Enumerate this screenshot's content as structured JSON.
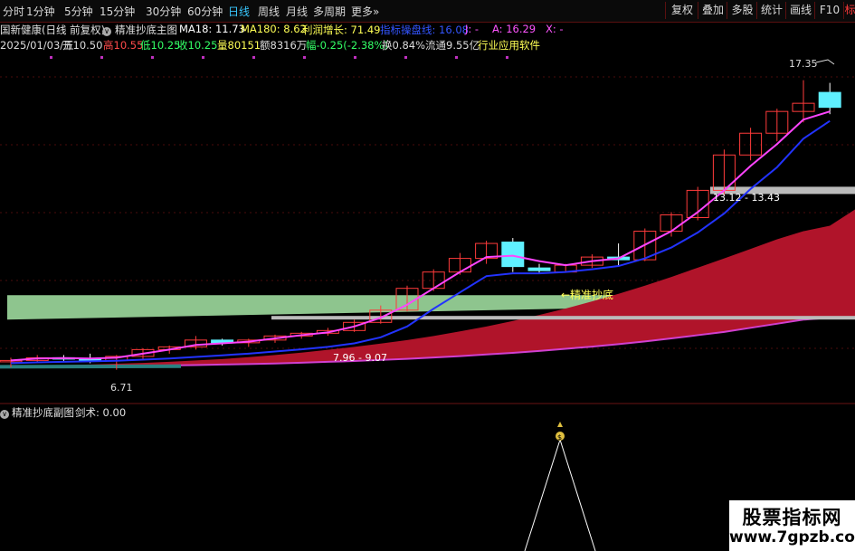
{
  "toolbar": {
    "timeframes": [
      "分时",
      "1分钟",
      "5分钟",
      "15分钟",
      "30分钟",
      "60分钟",
      "日线",
      "周线",
      "月线",
      "多周期",
      "更多"
    ],
    "active_timeframe": "日线",
    "right_buttons": [
      "复权",
      "叠加",
      "多股",
      "统计",
      "画线",
      "F10",
      "标"
    ],
    "active_right": "标"
  },
  "header": {
    "stock_name": "国新健康(日线 前复权)",
    "indicator_name": "精准抄底主图",
    "ma18_label": "MA18: 11.73",
    "ma180_label": "MA180: 8.62",
    "profit_label": "利润增长: 71.49",
    "extra_label": "指标操盘线: 16.08",
    "j_label": "J: -",
    "a_label": "A: 16.29",
    "x_label": "X: -",
    "date": "2025/01/03/五",
    "open_label": "开10.50",
    "high_label": "高10.55",
    "low_label": "低10.25",
    "close_label": "收10.25",
    "volume_label": "量80151",
    "amount_label": "额8316万",
    "change_label": "幅-0.25(-2.38%)",
    "turnover_label": "换0.84%",
    "float_label": "流通9.55亿",
    "industry_label": "行业应用软件"
  },
  "annotations": {
    "high_price": "17.35",
    "low_price": "6.71",
    "range_low": "7.96 - 9.07",
    "range_high": "13.12 - 13.43",
    "signal_text": "←精准抄底"
  },
  "sub_panel": {
    "title": "精准抄底副图",
    "value_label": "剑术: 0.00",
    "signal_marker": "$"
  },
  "watermark": {
    "line1": "股票指标网",
    "line2": "www.7gpzb.com"
  },
  "colors": {
    "up_candle": "#ff3b3b",
    "down_candle": "#5ff0ff",
    "ma_fast": "#ff44ff",
    "ma_slow": "#2233ff",
    "cloud_red": "#b0142a",
    "band_green": "#8ec58e",
    "active_tab": "#39c8ff"
  },
  "chart_data": {
    "type": "candlestick",
    "price_range": [
      6.0,
      18.3
    ],
    "candles": [
      {
        "o": 7.0,
        "h": 7.15,
        "l": 6.8,
        "c": 7.05
      },
      {
        "o": 7.05,
        "h": 7.25,
        "l": 6.95,
        "c": 7.15
      },
      {
        "o": 7.15,
        "h": 7.25,
        "l": 7.0,
        "c": 7.1
      },
      {
        "o": 7.1,
        "h": 7.3,
        "l": 6.95,
        "c": 7.05
      },
      {
        "o": 7.05,
        "h": 7.25,
        "l": 6.71,
        "c": 7.2
      },
      {
        "o": 7.2,
        "h": 7.5,
        "l": 7.1,
        "c": 7.45
      },
      {
        "o": 7.45,
        "h": 7.6,
        "l": 7.3,
        "c": 7.55
      },
      {
        "o": 7.55,
        "h": 7.95,
        "l": 7.45,
        "c": 7.8
      },
      {
        "o": 7.8,
        "h": 7.85,
        "l": 7.6,
        "c": 7.7
      },
      {
        "o": 7.7,
        "h": 7.85,
        "l": 7.55,
        "c": 7.8
      },
      {
        "o": 7.8,
        "h": 8.0,
        "l": 7.7,
        "c": 7.95
      },
      {
        "o": 7.95,
        "h": 8.1,
        "l": 7.85,
        "c": 8.05
      },
      {
        "o": 8.05,
        "h": 8.25,
        "l": 7.96,
        "c": 8.15
      },
      {
        "o": 8.15,
        "h": 8.55,
        "l": 8.1,
        "c": 8.45
      },
      {
        "o": 8.45,
        "h": 9.07,
        "l": 8.4,
        "c": 8.9
      },
      {
        "o": 8.9,
        "h": 9.8,
        "l": 8.85,
        "c": 9.7
      },
      {
        "o": 9.7,
        "h": 10.4,
        "l": 9.6,
        "c": 10.3
      },
      {
        "o": 10.3,
        "h": 11.0,
        "l": 10.2,
        "c": 10.8
      },
      {
        "o": 10.8,
        "h": 11.45,
        "l": 10.6,
        "c": 11.35
      },
      {
        "o": 11.4,
        "h": 11.55,
        "l": 10.3,
        "c": 10.5
      },
      {
        "o": 10.45,
        "h": 10.6,
        "l": 10.25,
        "c": 10.35
      },
      {
        "o": 10.3,
        "h": 10.6,
        "l": 10.3,
        "c": 10.55
      },
      {
        "o": 10.55,
        "h": 10.95,
        "l": 10.45,
        "c": 10.85
      },
      {
        "o": 10.85,
        "h": 11.35,
        "l": 10.55,
        "c": 10.75
      },
      {
        "o": 10.75,
        "h": 11.9,
        "l": 10.7,
        "c": 11.8
      },
      {
        "o": 11.8,
        "h": 12.5,
        "l": 11.6,
        "c": 12.4
      },
      {
        "o": 12.3,
        "h": 13.43,
        "l": 12.2,
        "c": 13.3
      },
      {
        "o": 13.3,
        "h": 14.8,
        "l": 13.12,
        "c": 14.6
      },
      {
        "o": 14.6,
        "h": 15.6,
        "l": 14.4,
        "c": 15.4
      },
      {
        "o": 15.4,
        "h": 16.3,
        "l": 15.1,
        "c": 16.2
      },
      {
        "o": 16.2,
        "h": 17.35,
        "l": 15.8,
        "c": 16.5
      },
      {
        "o": 16.9,
        "h": 17.25,
        "l": 16.1,
        "c": 16.35
      }
    ],
    "ma_fast": [
      7.05,
      7.12,
      7.14,
      7.12,
      7.15,
      7.3,
      7.45,
      7.62,
      7.68,
      7.74,
      7.86,
      7.98,
      8.08,
      8.3,
      8.62,
      9.1,
      9.7,
      10.3,
      10.85,
      10.9,
      10.7,
      10.55,
      10.7,
      10.8,
      11.3,
      11.8,
      12.5,
      13.3,
      14.2,
      15.0,
      15.9,
      16.2
    ],
    "ma_slow": [
      6.95,
      6.98,
      7.0,
      7.02,
      7.04,
      7.08,
      7.12,
      7.18,
      7.24,
      7.3,
      7.38,
      7.46,
      7.55,
      7.68,
      7.9,
      8.3,
      8.95,
      9.55,
      10.15,
      10.25,
      10.25,
      10.3,
      10.4,
      10.52,
      10.8,
      11.2,
      11.75,
      12.45,
      13.35,
      14.15,
      15.2,
      15.85
    ],
    "cloud_upper": [
      6.85,
      6.86,
      6.88,
      6.9,
      6.93,
      6.96,
      7.0,
      7.05,
      7.1,
      7.17,
      7.25,
      7.34,
      7.44,
      7.55,
      7.67,
      7.8,
      7.95,
      8.12,
      8.3,
      8.5,
      8.72,
      8.96,
      9.22,
      9.5,
      9.8,
      10.12,
      10.46,
      10.8,
      11.15,
      11.5,
      11.8,
      12.0
    ],
    "cloud_lower": [
      6.8,
      6.81,
      6.82,
      6.83,
      6.84,
      6.85,
      6.87,
      6.88,
      6.9,
      6.92,
      6.94,
      6.97,
      7.0,
      7.03,
      7.07,
      7.11,
      7.16,
      7.21,
      7.27,
      7.33,
      7.4,
      7.48,
      7.56,
      7.65,
      7.75,
      7.86,
      7.98,
      8.1,
      8.25,
      8.4,
      8.55,
      8.62
    ],
    "green_band": {
      "start": [
        9.45,
        8.55
      ],
      "end": [
        9.45,
        9.05
      ]
    },
    "support_lines": [
      8.62,
      13.3
    ]
  }
}
